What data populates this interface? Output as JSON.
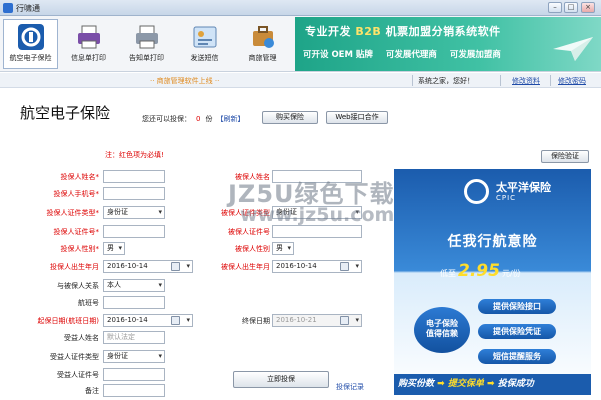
{
  "window": {
    "title": "行啸通",
    "minimize": "–",
    "maximize": "□",
    "close": "×"
  },
  "toolbar": {
    "buttons": [
      {
        "label": "航空电子保险",
        "icon": "ins-logo-icon"
      },
      {
        "label": "信息单打印",
        "icon": "printer-icon"
      },
      {
        "label": "告知单打印",
        "icon": "printer-icon"
      },
      {
        "label": "发送短信",
        "icon": "sms-icon"
      },
      {
        "label": "商旅管理",
        "icon": "travel-icon"
      }
    ]
  },
  "banner": {
    "line1_a": "专业开发",
    "line1_b": "B2B",
    "line1_c": "机票加盟分销系统软件",
    "line2": [
      "可开设 OEM 贴牌",
      "可发展代理商",
      "可发展加盟商"
    ]
  },
  "infobar": {
    "marquee": "·· 商旅管理软件上线 ··",
    "welcome": "系统之家，您好！",
    "edit_profile": "修改资料",
    "change_password": "修改密码"
  },
  "page": {
    "title": "航空电子保险",
    "balance_label": "您还可以投保：",
    "balance_value": "0",
    "balance_unit": "份",
    "refresh": "【刷新】",
    "buy_button": "购买保险",
    "web_button": "Web接口合作",
    "required_note": "注：红色项为必填!",
    "verify_button": "保险验证",
    "submit_button": "立即投保",
    "records_link": "投保记录"
  },
  "form": {
    "holder_name_label": "投保人姓名*",
    "holder_name_value": "",
    "holder_phone_label": "投保人手机号*",
    "holder_phone_value": "",
    "holder_id_type_label": "投保人证件类型*",
    "holder_id_type_value": "身份证",
    "holder_id_no_label": "投保人证件号*",
    "holder_id_no_value": "",
    "holder_gender_label": "投保人性别*",
    "holder_gender_value": "男",
    "holder_birth_label": "投保人出生年月",
    "holder_birth_value": "2016-10-14",
    "relation_label": "与被保人关系",
    "relation_value": "本人",
    "flight_label": "航班号",
    "flight_value": "",
    "start_label": "起保日期(航班日期)",
    "start_value": "2016-10-14",
    "end_label": "终保日期",
    "end_value": "2016-10-21",
    "benef_name_label": "受益人姓名",
    "benef_name_value": "默认法定",
    "benef_id_type_label": "受益人证件类型",
    "benef_id_type_value": "身份证",
    "benef_id_no_label": "受益人证件号",
    "benef_id_no_value": "",
    "remark_label": "备注",
    "remark_value": "",
    "insured_name_label": "被保人姓名",
    "insured_name_value": "",
    "insured_id_type_label": "被保人证件类型",
    "insured_id_type_value": "身份证",
    "insured_id_no_label": "被保人证件号",
    "insured_id_no_value": "",
    "insured_gender_label": "被保人性别",
    "insured_gender_value": "男",
    "insured_birth_label": "被保人出生年月",
    "insured_birth_value": "2016-10-14"
  },
  "ad": {
    "brand": "太平洋保险",
    "brand_en": "CPIC",
    "slogan": "任我行航意险",
    "price_prefix": "低至",
    "price": "2.95",
    "price_suffix": "元/份",
    "oval": [
      "电子保险",
      "值得信赖"
    ],
    "pills": [
      "提供保险接口",
      "提供保险凭证",
      "短信提醒服务"
    ],
    "strip": [
      "购买份数",
      "提交保单",
      "投保成功"
    ]
  },
  "watermark": {
    "line1": "JZ5U绿色下载",
    "line2": "www.jz5u.com"
  }
}
